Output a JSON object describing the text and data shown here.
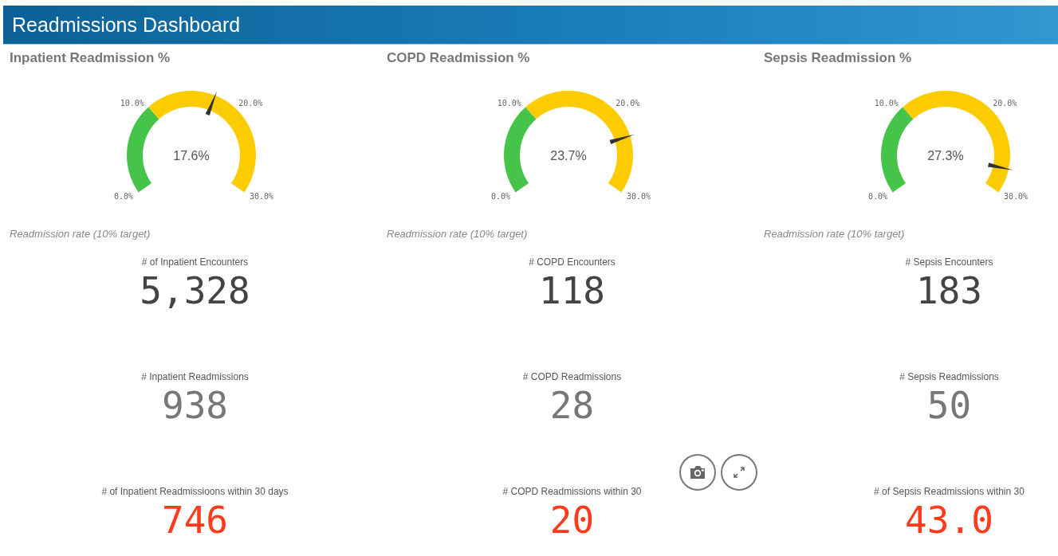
{
  "header": {
    "title": "Readmissions Dashboard"
  },
  "panels": [
    {
      "title": "Inpatient Readmission %",
      "gauge": {
        "reading": "17.6%",
        "ticks": [
          "0.0%",
          "10.0%",
          "20.0%",
          "30.0%"
        ],
        "bands": [
          {
            "color": "#46c44a"
          },
          {
            "color": "#fdcc00"
          }
        ]
      },
      "caption": "Readmission rate (10% target)",
      "kpis": [
        {
          "label": "# of Inpatient Encounters",
          "value": "5,328",
          "color": "#444444"
        },
        {
          "label": "# Inpatient Readmissions",
          "value": "938",
          "color": "#777777"
        },
        {
          "label": "# of Inpatient Readmissioons within 30 days",
          "value": "746",
          "color": "#ff3b1c"
        }
      ]
    },
    {
      "title": "COPD Readmission %",
      "gauge": {
        "reading": "23.7%",
        "ticks": [
          "0.0%",
          "10.0%",
          "20.0%",
          "30.0%"
        ],
        "bands": [
          {
            "color": "#46c44a"
          },
          {
            "color": "#fdcc00"
          }
        ]
      },
      "caption": "Readmission rate (10% target)",
      "kpis": [
        {
          "label": "# COPD Encounters",
          "value": "118",
          "color": "#444444"
        },
        {
          "label": "# COPD Readmissions",
          "value": "28",
          "color": "#777777"
        },
        {
          "label": "# COPD Readmissions within 30",
          "value": "20",
          "color": "#ff3b1c"
        }
      ]
    },
    {
      "title": "Sepsis Readmission %",
      "gauge": {
        "reading": "27.3%",
        "ticks": [
          "0.0%",
          "10.0%",
          "20.0%",
          "30.0%"
        ],
        "bands": [
          {
            "color": "#46c44a"
          },
          {
            "color": "#fdcc00"
          }
        ]
      },
      "caption": "Readmission rate (10% target)",
      "kpis": [
        {
          "label": "# Sepsis Encounters",
          "value": "183",
          "color": "#444444"
        },
        {
          "label": "# Sepsis Readmissions",
          "value": "50",
          "color": "#777777"
        },
        {
          "label": "# of Sepsis Readmissions within 30",
          "value": "43.0",
          "color": "#ff3b1c"
        }
      ]
    }
  ]
}
